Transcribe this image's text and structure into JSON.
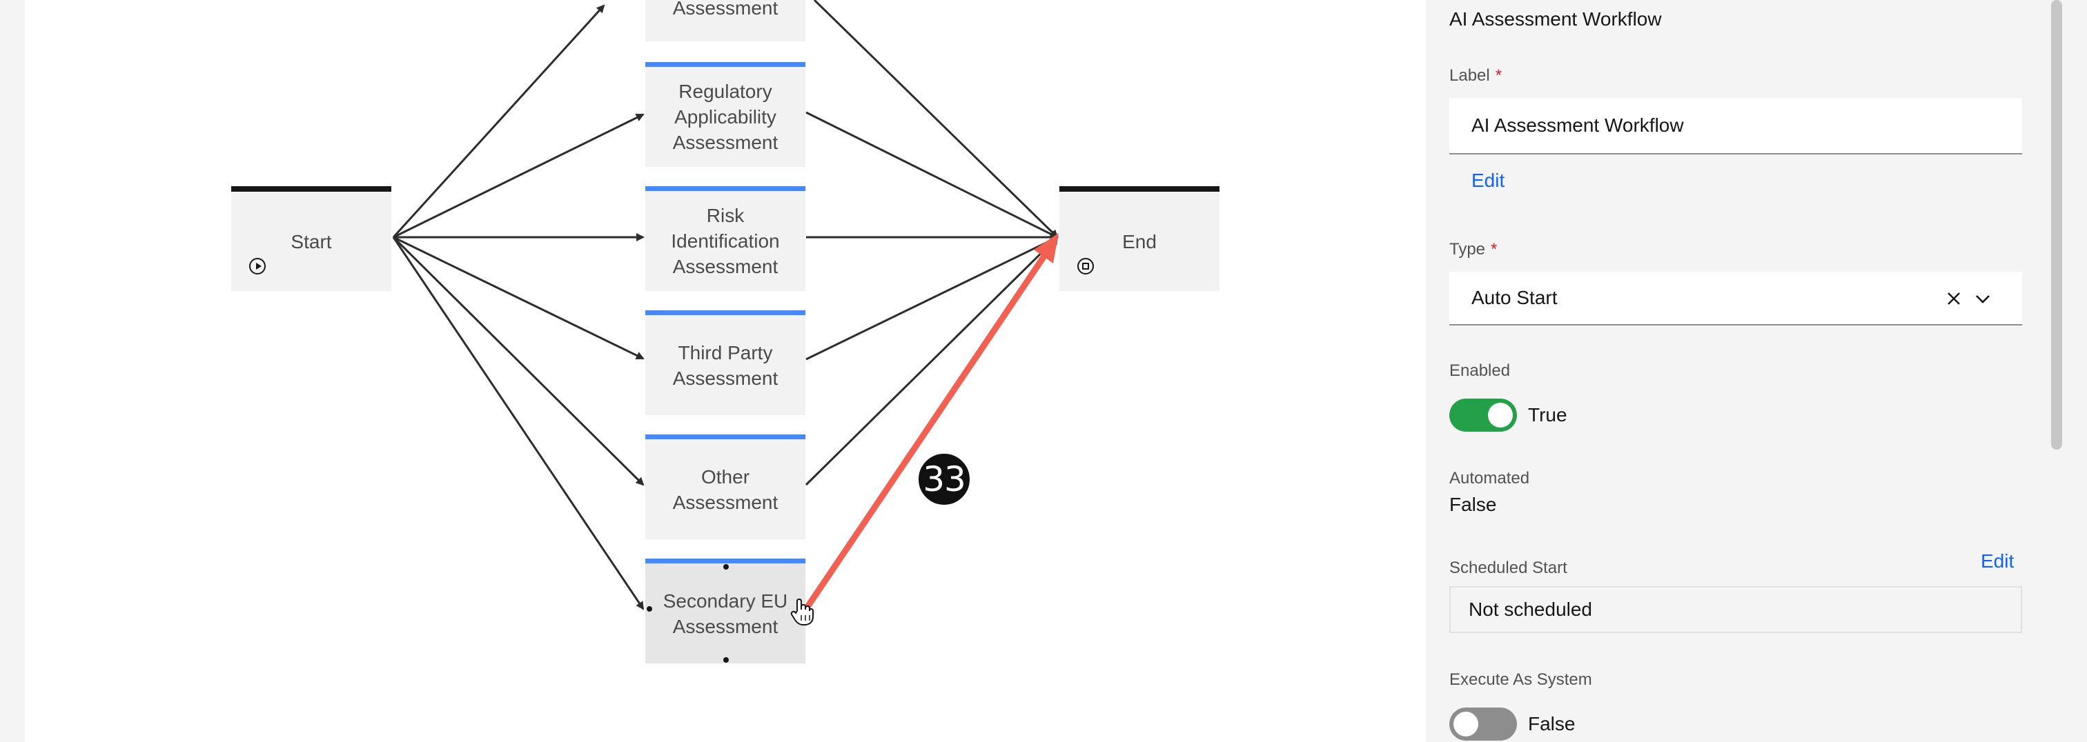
{
  "workflow": {
    "nodes": {
      "start": {
        "label": "Start",
        "icon": "play-circle-icon"
      },
      "end": {
        "label": "End",
        "icon": "stop-circle-icon"
      },
      "steps": [
        {
          "label": "Assessment"
        },
        {
          "label": "Regulatory\nApplicability\nAssessment"
        },
        {
          "label": "Risk\nIdentification\nAssessment"
        },
        {
          "label": "Third Party\nAssessment"
        },
        {
          "label": "Other\nAssessment"
        },
        {
          "label": "Secondary EU\nAssessment"
        }
      ]
    },
    "annotation": {
      "step_number": "33",
      "arrow_color": "#f26052"
    }
  },
  "panel": {
    "title": "AI Assessment Workflow",
    "label_field": {
      "label": "Label",
      "required_marker": "*",
      "value": "AI Assessment Workflow"
    },
    "edit_link": "Edit",
    "type_field": {
      "label": "Type",
      "required_marker": "*",
      "value": "Auto Start"
    },
    "enabled": {
      "label": "Enabled",
      "value": "True",
      "on": true
    },
    "automated": {
      "label": "Automated",
      "value": "False"
    },
    "scheduled_start": {
      "label": "Scheduled Start",
      "edit_link": "Edit",
      "value": "Not scheduled"
    },
    "execute_as_system": {
      "label": "Execute As System",
      "value": "False",
      "on": false
    }
  },
  "colors": {
    "accent_blue": "#4589ff",
    "link_blue": "#0f62fe",
    "toggle_on": "#24a148",
    "toggle_off": "#8d8d8d",
    "required_red": "#da1e28"
  }
}
